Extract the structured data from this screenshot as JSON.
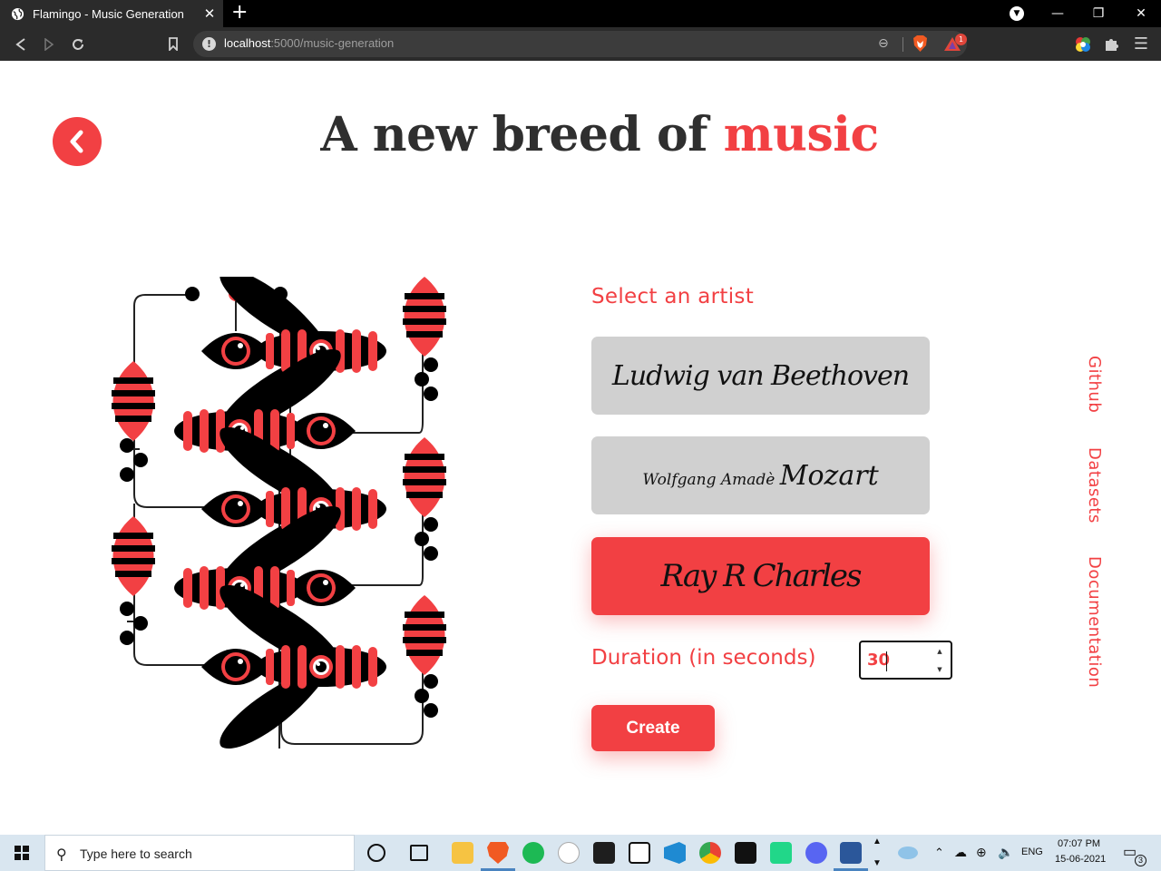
{
  "browser": {
    "tab_title": "Flamingo - Music Generation",
    "tab_close": "✕",
    "new_tab": "+",
    "url_host": "localhost",
    "url_path": ":5000/music-generation",
    "rewards_count": "1"
  },
  "page": {
    "headline_main": "A new breed of ",
    "headline_accent": "music",
    "select_label": "Select an artist",
    "artists": [
      {
        "name": "Beethoven",
        "signature": "Ludwig van Beethoven",
        "selected": false
      },
      {
        "name": "Mozart",
        "signature_small": "Wolfgang Amadè",
        "signature_big": "Mozart",
        "selected": false
      },
      {
        "name": "Ray Charles",
        "signature": "Ray R Charles",
        "selected": true
      }
    ],
    "duration_label": "Duration (in seconds)",
    "duration_value": "30",
    "create_label": "Create",
    "side_links": [
      "Github",
      "Datasets",
      "Documentation"
    ]
  },
  "taskbar": {
    "search_placeholder": "Type here to search",
    "lang": "ENG",
    "time": "07:07 PM",
    "date": "15-06-2021",
    "notification_count": "3"
  },
  "colors": {
    "accent": "#f24043",
    "heading": "#2f2f2f",
    "card_gray": "#d0d0d0"
  }
}
